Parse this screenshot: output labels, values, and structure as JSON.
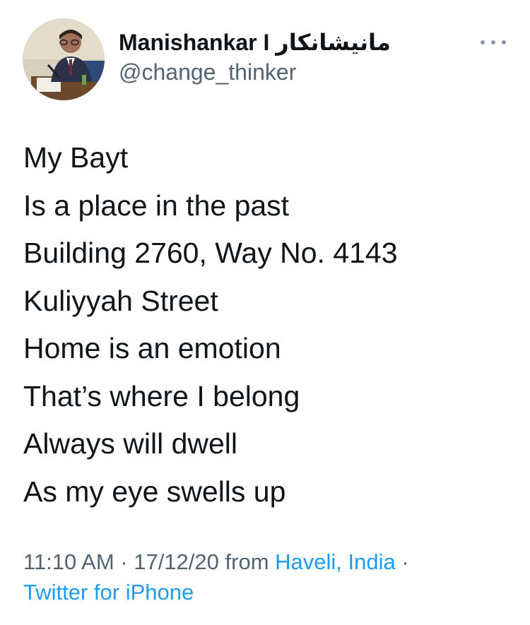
{
  "author": {
    "display_name": "Manishankar I مانیشانکار",
    "handle": "@change_thinker"
  },
  "tweet": {
    "lines": [
      "My Bayt",
      "Is a place in the past",
      "Building 2760, Way No. 4143",
      "Kuliyyah Street",
      "Home is an emotion",
      "That’s where I belong",
      "Always will dwell",
      "As my eye swells up"
    ]
  },
  "meta": {
    "time_date": "11:10 AM · 17/12/20",
    "from_label": "from",
    "location": "Haveli, India",
    "separator": "·",
    "source": "Twitter for iPhone"
  },
  "colors": {
    "text": "#0f1419",
    "secondary": "#536471",
    "link": "#1d9bf0"
  },
  "icons": {
    "more": "more-horizontal-icon"
  }
}
